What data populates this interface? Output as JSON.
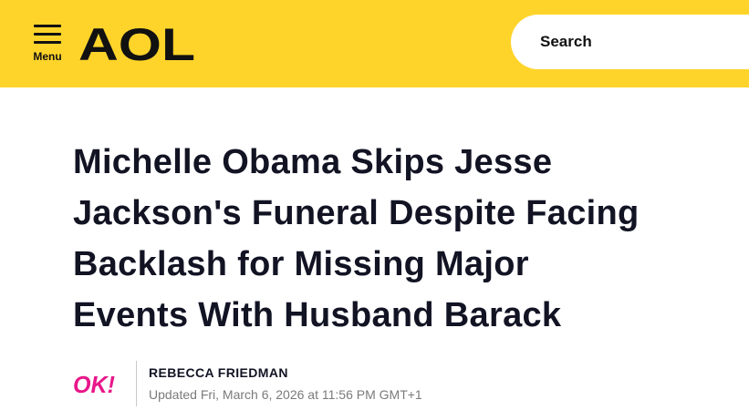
{
  "header": {
    "menu_label": "Menu",
    "logo_text": "AOL",
    "search_placeholder": "Search",
    "background_color": "#ffd42a"
  },
  "article": {
    "headline_lines": [
      "Michelle Obama Skips Jesse",
      "Jackson's Funeral Despite Facing",
      "Backlash for Missing Major",
      "Events With Husband Barack"
    ],
    "source_logo_text": "OK!",
    "source_logo_color": "#e8178a",
    "author": "REBECCA FRIEDMAN",
    "updated": "Updated Fri, March 6, 2026 at 11:56 PM GMT+1"
  }
}
